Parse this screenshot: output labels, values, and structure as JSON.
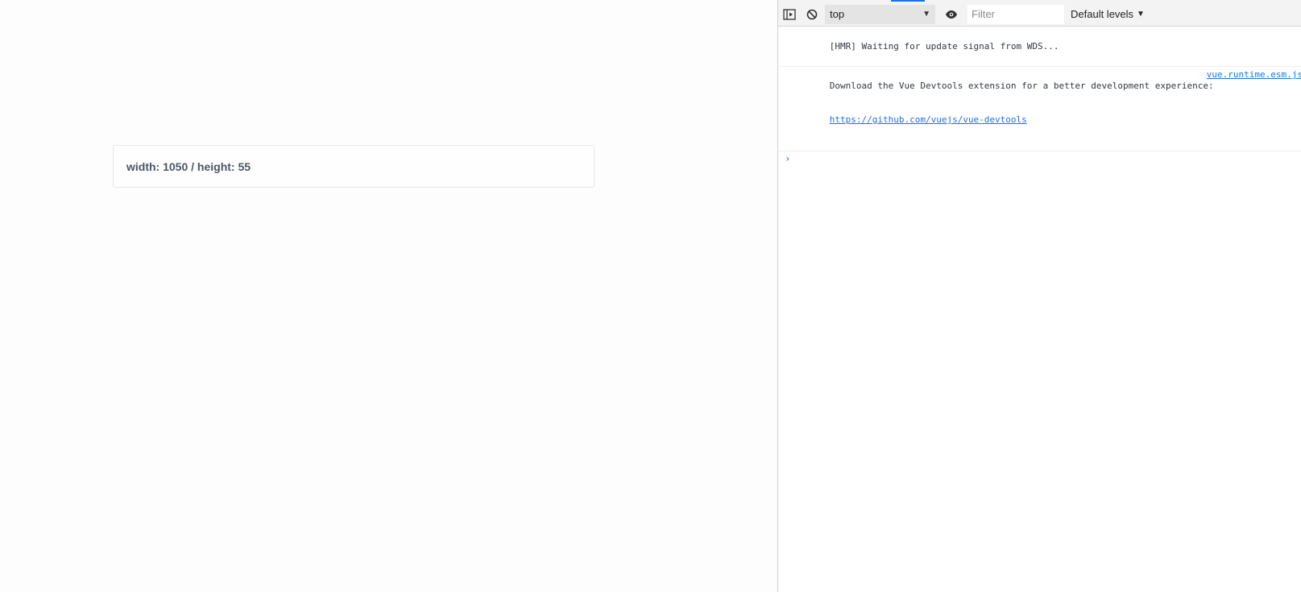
{
  "page": {
    "size_text": "width: 1050 / height: 55"
  },
  "devtools": {
    "context_value": "top",
    "filter_placeholder": "Filter",
    "levels_label": "Default levels",
    "messages": [
      {
        "text": "[HMR] Waiting for update signal from WDS...",
        "source": ""
      },
      {
        "text": "Download the Vue Devtools extension for a better development experience:",
        "url": "https://github.com/vuejs/vue-devtools",
        "source": "vue.runtime.esm.js"
      }
    ],
    "prompt_symbol": "›"
  },
  "icons": {
    "sidebar": "sidebar-toggle-icon",
    "clear": "clear-console-icon",
    "eye": "eye-icon",
    "dropdown": "chevron-down-icon"
  },
  "colors": {
    "link": "#1a73e8",
    "text": "#4c5567"
  }
}
